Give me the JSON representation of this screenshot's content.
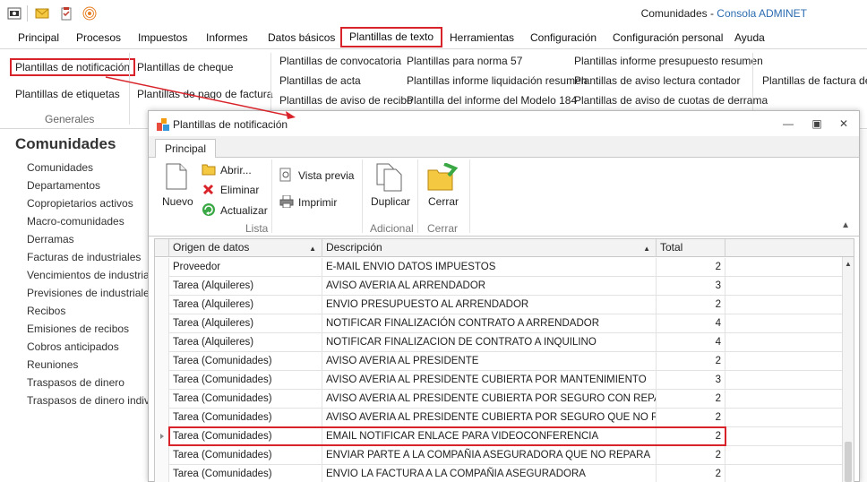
{
  "window": {
    "title": "Comunidades",
    "separator": " - ",
    "subtitle": "Consola ADMINET"
  },
  "menu": [
    {
      "label": "Principal",
      "active": false
    },
    {
      "label": "Procesos",
      "active": false
    },
    {
      "label": "Impuestos",
      "active": false
    },
    {
      "label": "Informes",
      "active": false
    },
    {
      "label": "Datos básicos",
      "active": false
    },
    {
      "label": "Plantillas de texto",
      "active": true
    },
    {
      "label": "Herramientas",
      "active": false
    },
    {
      "label": "Configuración",
      "active": false
    },
    {
      "label": "Configuración personal",
      "active": false
    },
    {
      "label": "Ayuda",
      "active": false
    }
  ],
  "ribbon": {
    "notificacion": "Plantillas de notificación",
    "etiquetas": "Plantillas de etiquetas",
    "generales": "Generales",
    "cheque": "Plantillas de cheque",
    "pago_factura": "Plantillas de pago de factura",
    "convocatoria": "Plantillas de convocatoria",
    "acta": "Plantillas de acta",
    "aviso_recibo": "Plantillas de aviso de recibo",
    "norma57": "Plantillas para norma 57",
    "informe_liq": "Plantillas informe liquidación resumen",
    "modelo184": "Plantilla del informe del Modelo 184",
    "presupuesto": "Plantillas informe presupuesto resumen",
    "aviso_lectura": "Plantillas de aviso lectura contador",
    "aviso_derrama": "Plantillas de aviso de cuotas de derrama",
    "factura": "Plantillas de factura del a"
  },
  "left": {
    "title": "Comunidades",
    "items": [
      "Comunidades",
      "Departamentos",
      "Copropietarios activos",
      "Macro-comunidades",
      "Derramas",
      "Facturas de industriales",
      "Vencimientos de industriales",
      "Previsiones de industriales",
      "Recibos",
      "Emisiones de recibos",
      "Cobros anticipados",
      "Reuniones",
      "Traspasos de dinero",
      "Traspasos de dinero individu"
    ]
  },
  "dialog": {
    "title": "Plantillas de notificación",
    "tab": "Principal",
    "buttons": {
      "nuevo": "Nuevo",
      "abrir": "Abrir...",
      "eliminar": "Eliminar",
      "actualizar": "Actualizar",
      "vista_previa": "Vista previa",
      "imprimir": "Imprimir",
      "duplicar": "Duplicar",
      "cerrar": "Cerrar"
    },
    "groups": {
      "lista": "Lista",
      "adicional": "Adicional",
      "cerrar": "Cerrar"
    },
    "columns": [
      "Origen de datos",
      "Descripción",
      "Total"
    ],
    "rows": [
      {
        "origen": "Proveedor",
        "descripcion": "E-MAIL ENVIO DATOS IMPUESTOS",
        "total": "2"
      },
      {
        "origen": "Tarea (Alquileres)",
        "descripcion": "AVISO AVERIA AL ARRENDADOR",
        "total": "3"
      },
      {
        "origen": "Tarea (Alquileres)",
        "descripcion": "ENVIO PRESUPUESTO AL ARRENDADOR",
        "total": "2"
      },
      {
        "origen": "Tarea (Alquileres)",
        "descripcion": "NOTIFICAR FINALIZACIÓN CONTRATO A ARRENDADOR",
        "total": "4"
      },
      {
        "origen": "Tarea (Alquileres)",
        "descripcion": "NOTIFICAR FINALIZACION DE CONTRATO A INQUILINO",
        "total": "4"
      },
      {
        "origen": "Tarea (Comunidades)",
        "descripcion": "AVISO AVERIA AL PRESIDENTE",
        "total": "2"
      },
      {
        "origen": "Tarea (Comunidades)",
        "descripcion": "AVISO AVERIA AL PRESIDENTE CUBIERTA POR MANTENIMIENTO",
        "total": "3"
      },
      {
        "origen": "Tarea (Comunidades)",
        "descripcion": "AVISO AVERIA AL PRESIDENTE CUBIERTA POR SEGURO CON REPARACI...",
        "total": "2"
      },
      {
        "origen": "Tarea (Comunidades)",
        "descripcion": "AVISO AVERIA AL PRESIDENTE CUBIERTA POR SEGURO QUE NO REPARA",
        "total": "2"
      },
      {
        "origen": "Tarea (Comunidades)",
        "descripcion": "EMAIL NOTIFICAR ENLACE PARA VIDEOCONFERENCIA",
        "total": "2"
      },
      {
        "origen": "Tarea (Comunidades)",
        "descripcion": "ENVIAR PARTE A LA COMPAÑIA ASEGURADORA QUE NO REPARA",
        "total": "2"
      },
      {
        "origen": "Tarea (Comunidades)",
        "descripcion": "ENVIO LA FACTURA A LA COMPAÑIA ASEGURADORA",
        "total": "2"
      }
    ]
  },
  "colors": {
    "highlight": "#d9232a",
    "subtitle": "#2b6cb0"
  }
}
